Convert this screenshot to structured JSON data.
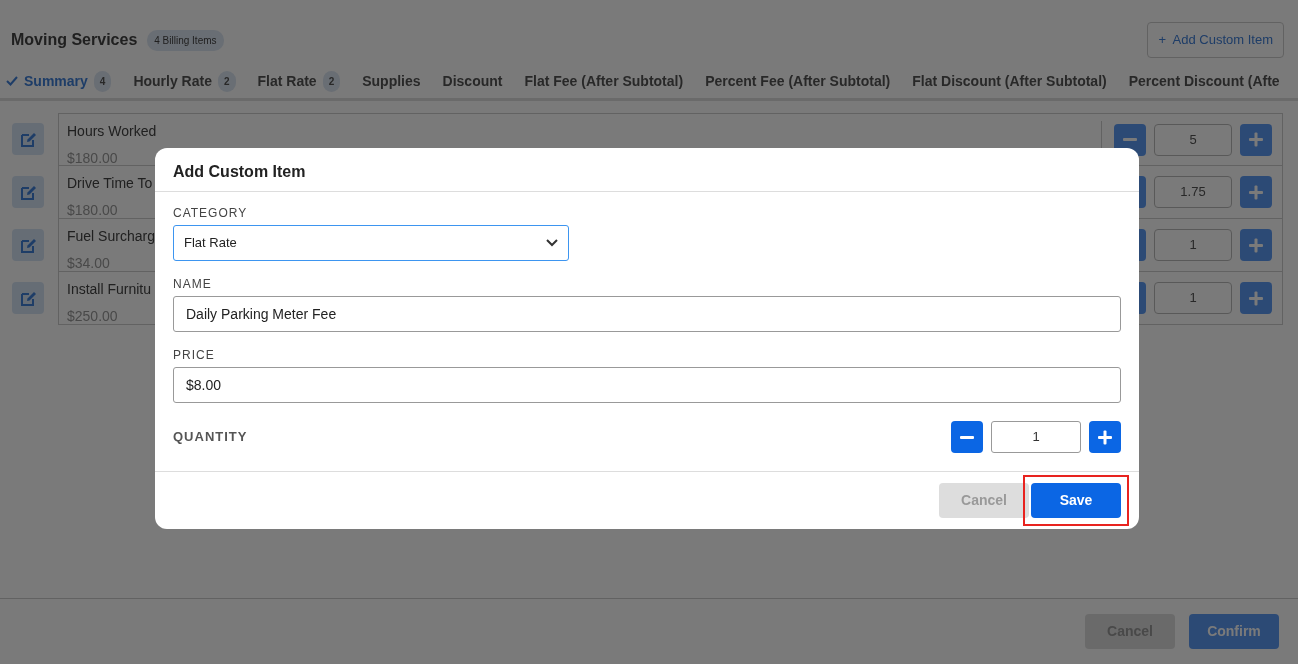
{
  "header": {
    "title": "Moving Services",
    "badge": "4 Billing Items",
    "add_button": {
      "icon": "+",
      "label": "Add Custom Item"
    }
  },
  "tabs": [
    {
      "label": "Summary",
      "count": "4",
      "selected": true
    },
    {
      "label": "Hourly Rate",
      "count": "2",
      "selected": false
    },
    {
      "label": "Flat Rate",
      "count": "2",
      "selected": false
    },
    {
      "label": "Supplies",
      "selected": false
    },
    {
      "label": "Discount",
      "selected": false
    },
    {
      "label": "Flat Fee (After Subtotal)",
      "selected": false
    },
    {
      "label": "Percent Fee (After Subtotal)",
      "selected": false
    },
    {
      "label": "Flat Discount (After Subtotal)",
      "selected": false
    },
    {
      "label": "Percent Discount (Afte",
      "selected": false
    }
  ],
  "items": [
    {
      "name": "Hours Worked",
      "price": "$180.00",
      "quantity": "5"
    },
    {
      "name": "Drive Time To",
      "price": "$180.00",
      "quantity": "1.75"
    },
    {
      "name": "Fuel Surcharg",
      "price": "$34.00",
      "quantity": "1"
    },
    {
      "name": "Install Furnitu",
      "price": "$250.00",
      "quantity": "1"
    }
  ],
  "footer_buttons": [
    {
      "label": "Cancel",
      "kind": "secondary",
      "disabled": true
    },
    {
      "label": "Confirm",
      "kind": "primary",
      "disabled": false
    }
  ],
  "modal": {
    "title": "Add Custom Item",
    "fields": [
      {
        "label": "CATEGORY",
        "kind": "select",
        "value": "Flat Rate",
        "focused": true
      },
      {
        "label": "NAME",
        "kind": "text",
        "value": "Daily Parking Meter Fee",
        "focused": false
      },
      {
        "label": "PRICE",
        "kind": "text",
        "value": "$8.00",
        "focused": false
      }
    ],
    "quantity": {
      "label": "QUANTITY",
      "value": "1"
    },
    "buttons": [
      {
        "label": "Cancel",
        "kind": "secondary",
        "disabled": true,
        "highlighted": false
      },
      {
        "label": "Save",
        "kind": "primary",
        "disabled": false,
        "highlighted": true
      }
    ]
  }
}
